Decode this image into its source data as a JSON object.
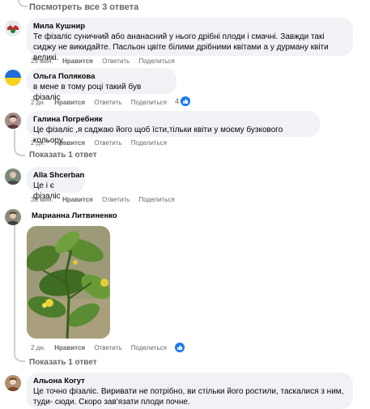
{
  "view_all_replies": "Посмотреть все 3 ответа",
  "show_one_reply": "Показать 1 ответ",
  "show_one_reply_2": "Показать 1 ответ",
  "actions": {
    "like": "Нравится",
    "reply": "Ответить",
    "share": "Поделиться"
  },
  "comments": [
    {
      "author": "Мила Кушнир",
      "text": "Те фізаліс суничний або ананасний у нього дрібні плоди і смачні. Завжди такі сиджу не викидайте. Пасльон цвіте білими дрібними квітами а у дурману квіти великі.",
      "time": "29 мин."
    },
    {
      "author": "Ольга Полякова",
      "text": "в мене в тому році такий був фізаліс",
      "time": "2 дн.",
      "reaction_count": "4"
    },
    {
      "author": "Галина Погребняк",
      "text": "Це фізаліс ,я саджаю його щоб їсти,тільки квіти у моєму бузкового кольору.",
      "time": "2 дн."
    },
    {
      "author": "Alla Shcerban",
      "text": "Це і є фізаліс",
      "time": "36 мин."
    },
    {
      "author": "Марианна Литвиненко",
      "text": "",
      "time": "2 дн."
    },
    {
      "author": "Альона Когут",
      "text": "Це точно фізаліс. Виривати не потрібно, ви стільки його ростили, таскалися з ним, туди- сюди. Скоро зав'язати плоди почне.",
      "time": ""
    }
  ],
  "colors": {
    "accent": "#1877f2",
    "bubble": "#f0f2f5",
    "meta": "#65676b"
  }
}
